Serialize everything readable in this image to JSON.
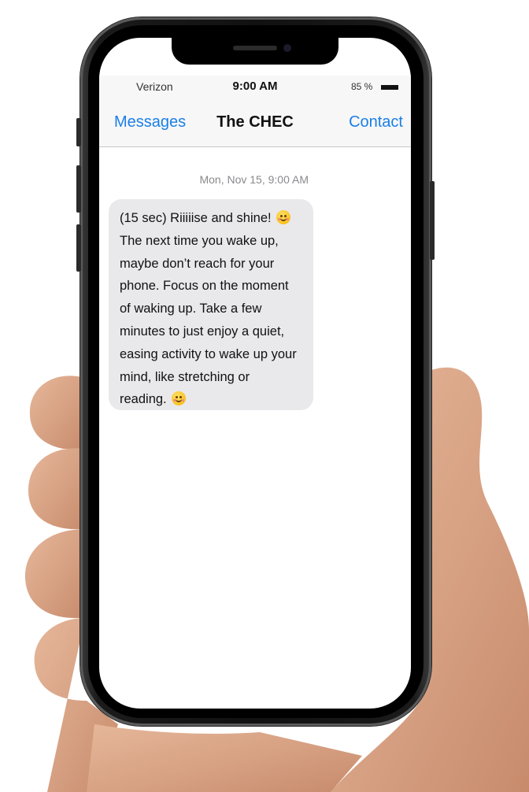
{
  "status_bar": {
    "carrier": "Verizon",
    "time": "9:00 AM",
    "battery": "85 %"
  },
  "nav_bar": {
    "back_label": "Messages",
    "title": "The CHEC",
    "contact_label": "Contact"
  },
  "conversation": {
    "timestamp": "Mon, Nov 15, 9:00 AM",
    "message_lines": [
      "(15 sec) Riiiiise and shine!",
      "The next time you wake up,",
      "maybe don’t reach for your",
      "phone. Focus on the moment",
      "of waking up. Take a few",
      "minutes to just enjoy a quiet,",
      "easing activity to wake up your",
      "mind, like stretching or",
      "reading."
    ],
    "emojis": [
      "smiling-face-emoji",
      "smiling-face-blush-emoji"
    ]
  },
  "colors": {
    "link_blue": "#1a7fe8",
    "bubble_gray": "#e9e9eb",
    "bar_background": "#f7f7f7"
  }
}
